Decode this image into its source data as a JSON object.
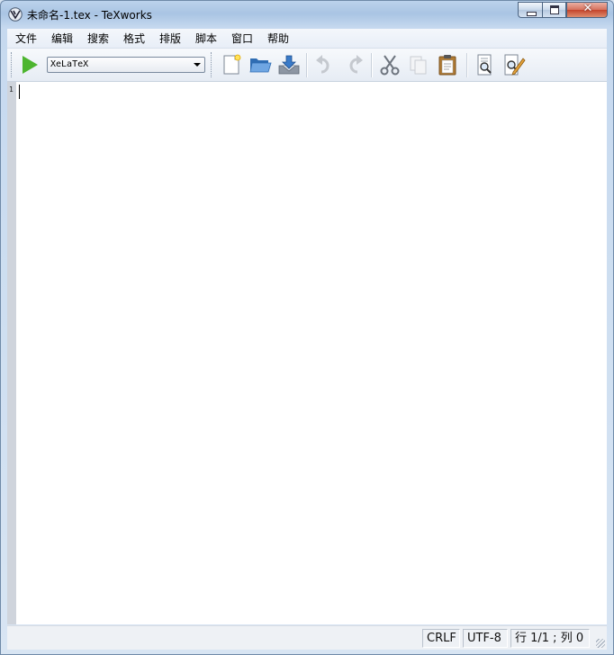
{
  "window": {
    "title": "未命名-1.tex - TeXworks",
    "close_glyph": "✕"
  },
  "menu": [
    {
      "label": "文件"
    },
    {
      "label": "编辑"
    },
    {
      "label": "搜索"
    },
    {
      "label": "格式"
    },
    {
      "label": "排版"
    },
    {
      "label": "脚本"
    },
    {
      "label": "窗口"
    },
    {
      "label": "帮助"
    }
  ],
  "toolbar": {
    "engine_selected": "XeLaTeX",
    "icons": [
      "typeset-icon",
      "new-document-icon",
      "open-folder-icon",
      "save-icon",
      "undo-icon",
      "redo-icon",
      "cut-icon",
      "copy-icon",
      "paste-icon",
      "find-icon",
      "replace-icon"
    ]
  },
  "editor": {
    "line_number": "1",
    "content": ""
  },
  "status": {
    "line_ending": "CRLF",
    "encoding": "UTF-8",
    "position": "行 1/1 ; 列 0"
  },
  "colors": {
    "typeset_green": "#4db52f",
    "folder_blue": "#3f7fc4",
    "close_red": "#c4442b"
  }
}
